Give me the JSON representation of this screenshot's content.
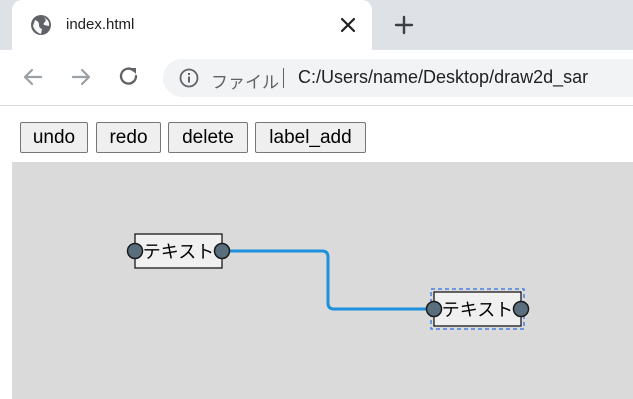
{
  "browser": {
    "tab": {
      "title": "index.html",
      "favicon": "globe-icon"
    },
    "new_tab_icon": "plus-icon",
    "toolbar": {
      "back_icon": "arrow-left-icon",
      "forward_icon": "arrow-right-icon",
      "reload_icon": "reload-icon",
      "scheme_label": "ファイル",
      "url": "C:/Users/name/Desktop/draw2d_sar"
    }
  },
  "app": {
    "buttons": {
      "undo": "undo",
      "redo": "redo",
      "delete": "delete",
      "label_add": "label_add"
    },
    "canvas": {
      "background": "#dadada",
      "shapes": [
        {
          "id": "node-1",
          "label": "テキスト",
          "selected": false
        },
        {
          "id": "node-2",
          "label": "テキスト",
          "selected": true
        }
      ],
      "connection": {
        "from": "node-1",
        "to": "node-2",
        "color": "#1e90dc"
      },
      "port_color": "#5a6f7d",
      "selection_color": "#4a7fe0"
    }
  }
}
